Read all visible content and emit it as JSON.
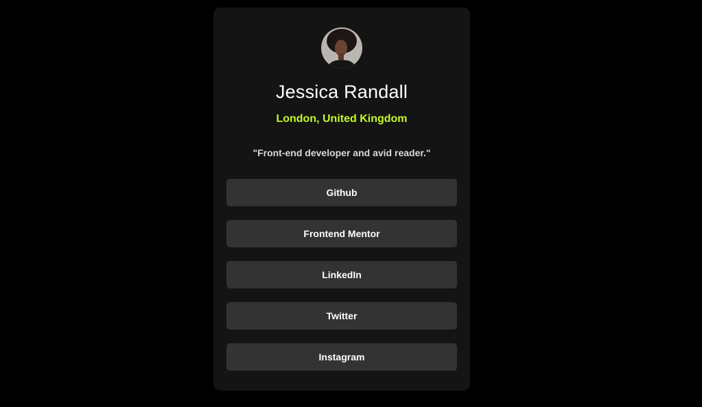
{
  "profile": {
    "name": "Jessica Randall",
    "location": "London, United Kingdom",
    "bio": "\"Front-end developer and avid reader.\""
  },
  "links": [
    {
      "label": "Github"
    },
    {
      "label": "Frontend Mentor"
    },
    {
      "label": "LinkedIn"
    },
    {
      "label": "Twitter"
    },
    {
      "label": "Instagram"
    }
  ],
  "colors": {
    "page_bg": "#000000",
    "card_bg": "#141414",
    "button_bg": "#333333",
    "accent": "#c4f82a",
    "text": "#ffffff"
  }
}
